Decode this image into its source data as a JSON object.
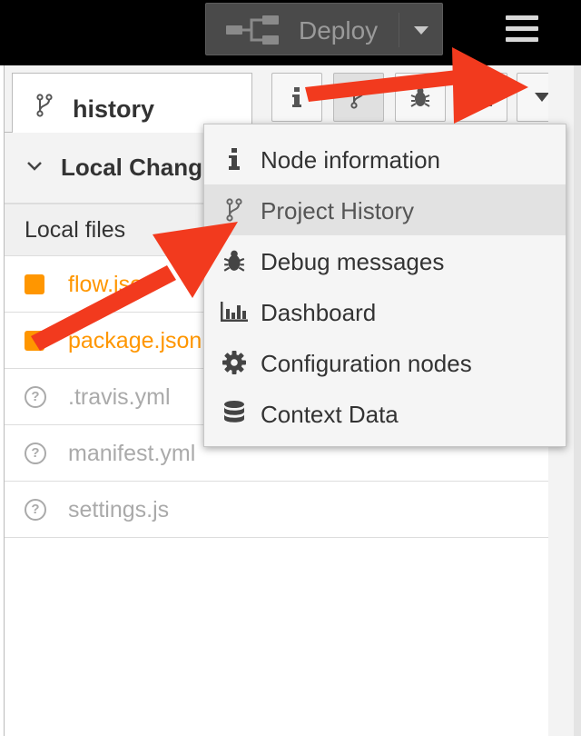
{
  "header": {
    "deploy_label": "Deploy",
    "menu_icon": "hamburger-menu-icon"
  },
  "sidebar": {
    "active_tab_label": "history",
    "tab_buttons": [
      {
        "icon": "info-icon",
        "selected": false
      },
      {
        "icon": "git-branch-icon",
        "selected": true
      },
      {
        "icon": "bug-icon",
        "selected": false
      },
      {
        "icon": "dashboard-icon",
        "selected": false
      },
      {
        "icon": "caret-down-icon",
        "selected": false
      }
    ],
    "section_title": "Local Changes",
    "files_header": "Local files",
    "files": [
      {
        "name": "flow.json",
        "status": "modified"
      },
      {
        "name": "package.json",
        "status": "modified"
      },
      {
        "name": ".travis.yml",
        "status": "untracked"
      },
      {
        "name": "manifest.yml",
        "status": "untracked"
      },
      {
        "name": "settings.js",
        "status": "untracked"
      }
    ]
  },
  "menu": {
    "items": [
      {
        "label": "Node information",
        "icon": "info-icon"
      },
      {
        "label": "Project History",
        "icon": "git-branch-icon",
        "highlighted": true
      },
      {
        "label": "Debug messages",
        "icon": "bug-icon"
      },
      {
        "label": "Dashboard",
        "icon": "bar-chart-icon"
      },
      {
        "label": "Configuration nodes",
        "icon": "gear-icon"
      },
      {
        "label": "Context Data",
        "icon": "database-icon"
      }
    ]
  },
  "colors": {
    "header_bg": "#000000",
    "modified": "#ff9600",
    "untracked": "#aaaaaa",
    "arrow": "#f23a1e"
  }
}
